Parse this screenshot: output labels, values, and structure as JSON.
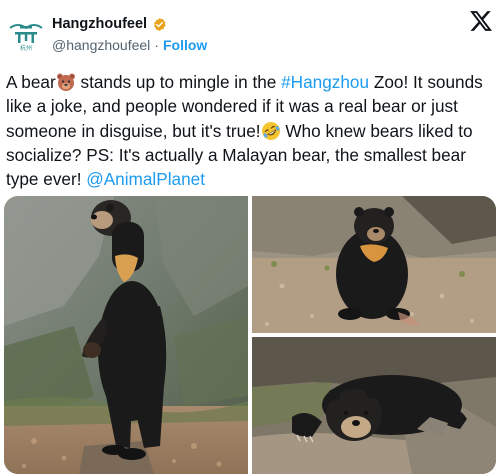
{
  "author": {
    "display_name": "Hangzhoufeel",
    "handle": "@hangzhoufeel",
    "separator": "·",
    "follow_label": "Follow",
    "logo_text": "杭州"
  },
  "tweet": {
    "part1": "A bear",
    "part2": " stands up to mingle in the ",
    "hashtag": "#Hangzhou",
    "part3": " Zoo! It sounds like a joke, and people wondered if it was a real bear or just someone in disguise, but it's true!",
    "part4": " Who knew bears liked to socialize? PS: It's actually a Malayan bear, the smallest bear type ever! ",
    "mention": "@AnimalPlanet"
  },
  "icons": {
    "verified": "verified-badge-icon",
    "x_logo": "x-logo-icon",
    "bear_emoji": "bear-face-emoji",
    "laugh_emoji": "rolling-laughing-emoji"
  },
  "colors": {
    "link": "#1d9bf0",
    "verified": "#e8a31a",
    "text": "#0f1419",
    "secondary": "#536471"
  }
}
